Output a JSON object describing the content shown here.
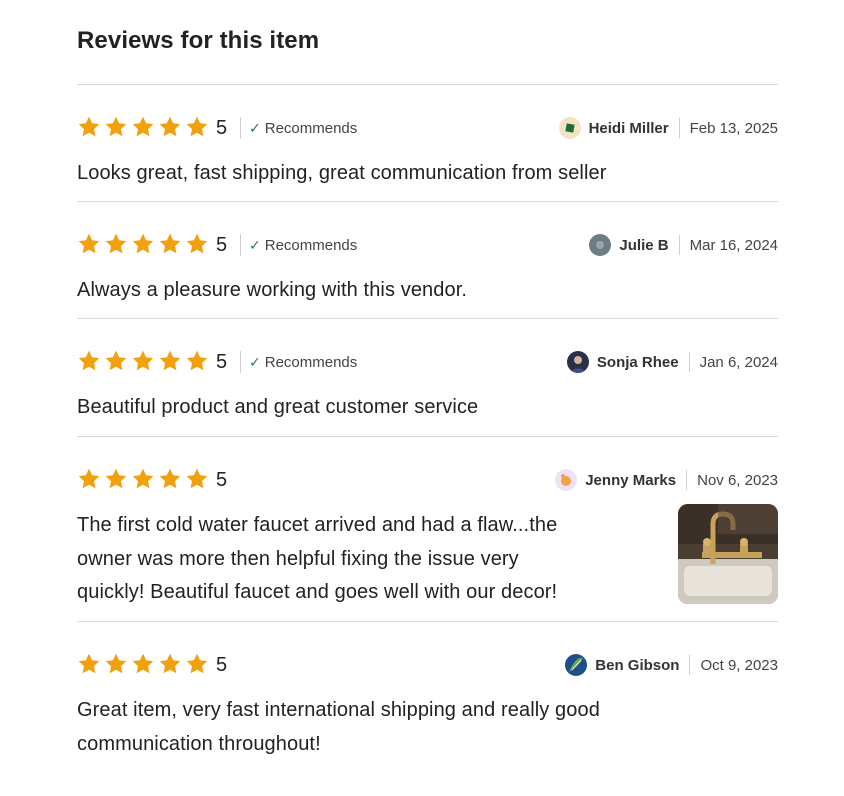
{
  "section": {
    "title": "Reviews for this item"
  },
  "colors": {
    "star": "#f1a10d",
    "check": "#2c7a4b",
    "divider": "#dcdcdc"
  },
  "reviews": [
    {
      "rating": "5",
      "recommends": "Recommends",
      "reviewer": "Heidi Miller",
      "date": "Feb 13, 2025",
      "text": "Looks great, fast shipping, great communication from seller"
    },
    {
      "rating": "5",
      "recommends": "Recommends",
      "reviewer": "Julie B",
      "date": "Mar 16, 2024",
      "text": "Always a pleasure working with this vendor."
    },
    {
      "rating": "5",
      "recommends": "Recommends",
      "reviewer": "Sonja Rhee",
      "date": "Jan 6, 2024",
      "text": "Beautiful product and great customer service"
    },
    {
      "rating": "5",
      "recommends": "",
      "reviewer": "Jenny Marks",
      "date": "Nov 6, 2023",
      "text_lines": [
        "The first cold water faucet arrived and had a flaw...the",
        "owner was more then helpful fixing the issue very",
        "quickly! Beautiful faucet and goes well with our decor!"
      ],
      "photo_icon": "faucet-photo"
    },
    {
      "rating": "5",
      "recommends": "",
      "reviewer": "Ben Gibson",
      "date": "Oct 9, 2023",
      "text_lines": [
        "Great item, very fast international shipping and really good",
        "communication throughout!"
      ]
    }
  ]
}
